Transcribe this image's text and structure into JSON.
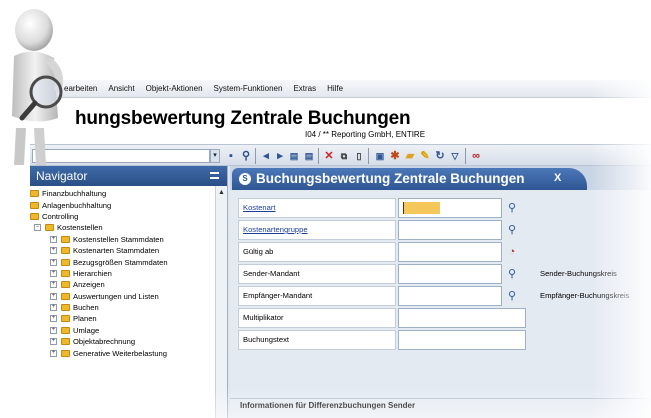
{
  "menubar": {
    "items": [
      "earbeiten",
      "Ansicht",
      "Objekt-Aktionen",
      "System-Funktionen",
      "Extras",
      "Hilfe"
    ]
  },
  "header": {
    "title": "hungsbewertung Zentrale Buchungen",
    "subtitle": "I04 / **   Reporting GmbH,  ENTIRE"
  },
  "toolbar": {
    "dropdown_glyph": "▾",
    "buttons": [
      "save-icon",
      "find-icon",
      "first-icon",
      "prev-icon",
      "next-icon",
      "last-icon",
      "delete-icon",
      "copy-icon",
      "new-icon",
      "print-icon",
      "settings-icon",
      "folder-icon",
      "edit-icon",
      "refresh-icon",
      "filter-icon",
      "link-icon"
    ]
  },
  "navigator": {
    "title": "Navigator",
    "items": [
      {
        "label": "Finanzbuchhaltung"
      },
      {
        "label": "Anlagenbuchhaltung"
      },
      {
        "label": "Controlling"
      },
      {
        "label": "Kostenstellen",
        "expander": "−"
      },
      {
        "label": "Kostenstellen Stammdaten",
        "expander": "+"
      },
      {
        "label": "Kostenarten Stammdaten",
        "expander": "+"
      },
      {
        "label": "Bezugsgrößen Stammdaten",
        "expander": "+"
      },
      {
        "label": "Hierarchien",
        "expander": "+"
      },
      {
        "label": "Anzeigen",
        "expander": "+"
      },
      {
        "label": "Auswertungen und Listen",
        "expander": "+"
      },
      {
        "label": "Buchen",
        "expander": "+"
      },
      {
        "label": "Planen",
        "expander": "+"
      },
      {
        "label": "Umlage",
        "expander": "+"
      },
      {
        "label": "Objektabrechnung",
        "expander": "+"
      },
      {
        "label": "Generative Weiterbelastung",
        "expander": "+"
      }
    ],
    "scroll_up": "▲"
  },
  "main": {
    "tab": {
      "icon": "S",
      "label": "Buchungsbewertung Zentrale Buchungen",
      "close": "X"
    },
    "fields": [
      {
        "label": "Kostenart",
        "value": ""
      },
      {
        "label": "Kostenartengruppe",
        "value": ""
      },
      {
        "label": "Gültig ab",
        "value": ""
      },
      {
        "label": "Sender-Mandant",
        "value": "",
        "right_label": "Sender-Buchungskreis"
      },
      {
        "label": "Empfänger-Mandant",
        "value": "",
        "right_label": "Empfänger-Buchungskreis"
      },
      {
        "label": "Multiplikator",
        "value": ""
      },
      {
        "label": "Buchungstext",
        "value": ""
      }
    ],
    "section_title": "Informationen für Differenzbuchungen Sender"
  },
  "colors": {
    "accent": "#2f5694",
    "focus_highlight": "#f6c75a",
    "folder": "#f0b62c"
  }
}
